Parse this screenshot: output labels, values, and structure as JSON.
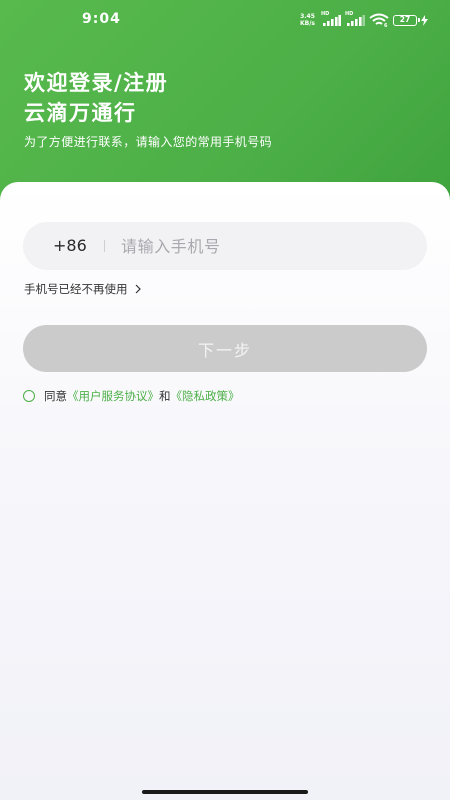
{
  "status_bar": {
    "time": "9:04",
    "net_speed_value": "3.45",
    "net_speed_unit": "KB/s",
    "signal1_label": "HD",
    "signal2_label": "HD",
    "wifi_label": "6",
    "battery_level": "27",
    "icons": [
      "signal-icon",
      "wifi-icon",
      "battery-icon",
      "charging-icon"
    ]
  },
  "header": {
    "title": "欢迎登录/注册",
    "app_name": "云滴万通行",
    "subtitle": "为了方便进行联系，请输入您的常用手机号码"
  },
  "form": {
    "country_code": "+86",
    "phone_placeholder": "请输入手机号",
    "phone_value": "",
    "no_longer_used_label": "手机号已经不再使用",
    "next_button_label": "下一步",
    "agree_prefix": "同意",
    "user_agreement": "《用户服务协议》",
    "agree_and": "和",
    "privacy_policy": "《隐私政策》"
  },
  "colors": {
    "brand_green": "#4caf47",
    "disabled_button": "#cbcbcb"
  }
}
